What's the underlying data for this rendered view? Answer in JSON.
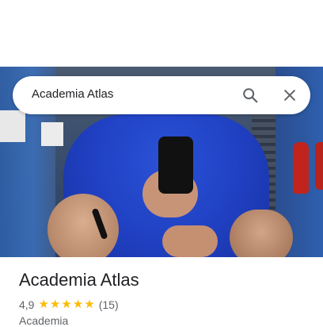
{
  "search": {
    "query": "Academia Atlas",
    "search_icon": "search-icon",
    "close_icon": "close-icon"
  },
  "place": {
    "name": "Academia Atlas",
    "rating": "4,9",
    "rating_value": 4.9,
    "stars_shown": 5,
    "review_count": "(15)",
    "category": "Academia"
  },
  "colors": {
    "star": "#fbbc04",
    "text_primary": "#202124",
    "text_secondary": "#5f6368"
  }
}
